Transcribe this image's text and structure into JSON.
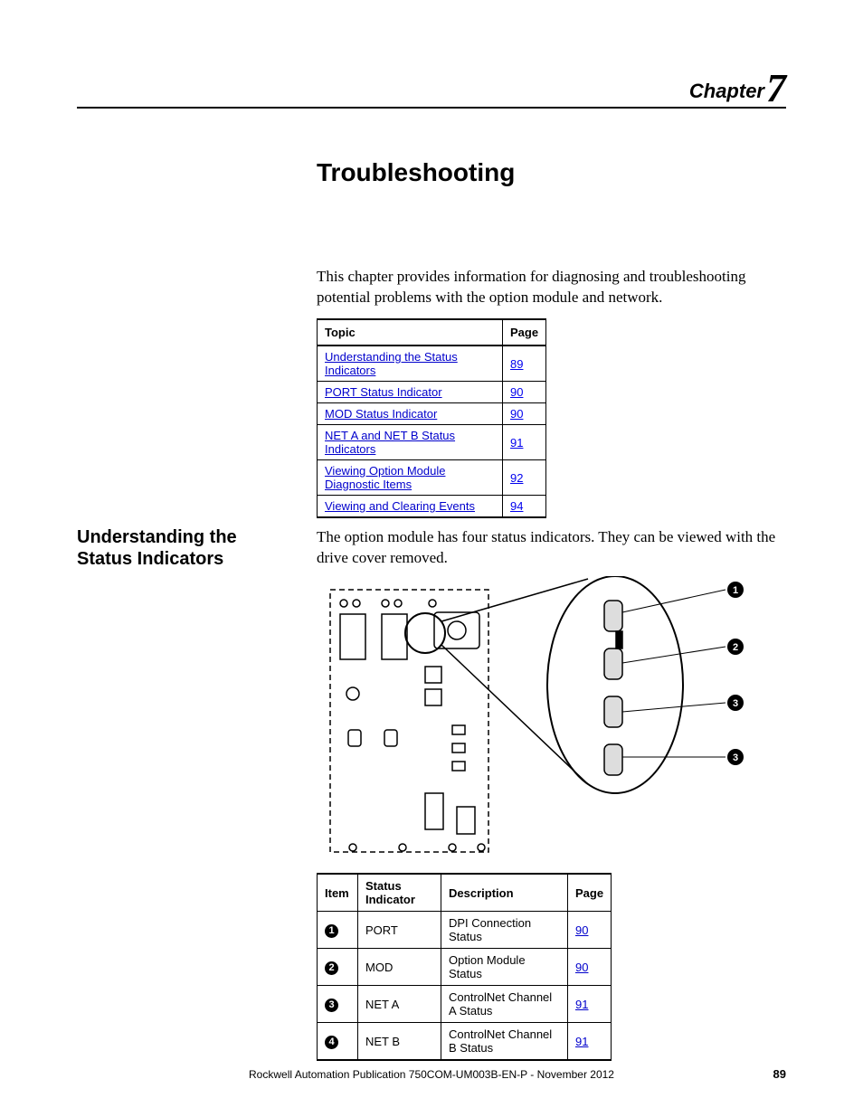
{
  "chapter": {
    "label": "Chapter",
    "number": "7"
  },
  "title": "Troubleshooting",
  "intro": "This chapter provides information for diagnosing and troubleshooting potential problems with the option module and network.",
  "topics": {
    "headers": {
      "topic": "Topic",
      "page": "Page"
    },
    "rows": [
      {
        "topic": "Understanding the Status Indicators",
        "page": "89"
      },
      {
        "topic": "PORT Status Indicator",
        "page": "90"
      },
      {
        "topic": "MOD Status Indicator",
        "page": "90"
      },
      {
        "topic": "NET A and NET B Status Indicators",
        "page": "91"
      },
      {
        "topic": "Viewing Option Module Diagnostic Items",
        "page": "92"
      },
      {
        "topic": "Viewing and Clearing Events",
        "page": "94"
      }
    ]
  },
  "section": {
    "heading": "Understanding the Status Indicators",
    "para": "The option module has four status indicators. They can be viewed with the drive cover removed."
  },
  "callouts": [
    "1",
    "2",
    "3",
    "3"
  ],
  "indicators": {
    "headers": {
      "item": "Item",
      "status": "Status Indicator",
      "desc": "Description",
      "page": "Page"
    },
    "rows": [
      {
        "item": "1",
        "status": "PORT",
        "desc": "DPI Connection Status",
        "page": "90"
      },
      {
        "item": "2",
        "status": "MOD",
        "desc": "Option Module Status",
        "page": "90"
      },
      {
        "item": "3",
        "status": "NET A",
        "desc": "ControlNet Channel A Status",
        "page": "91"
      },
      {
        "item": "4",
        "status": "NET B",
        "desc": "ControlNet Channel B Status",
        "page": "91"
      }
    ]
  },
  "footer": {
    "publication": "Rockwell Automation Publication 750COM-UM003B-EN-P - November 2012",
    "page": "89"
  }
}
